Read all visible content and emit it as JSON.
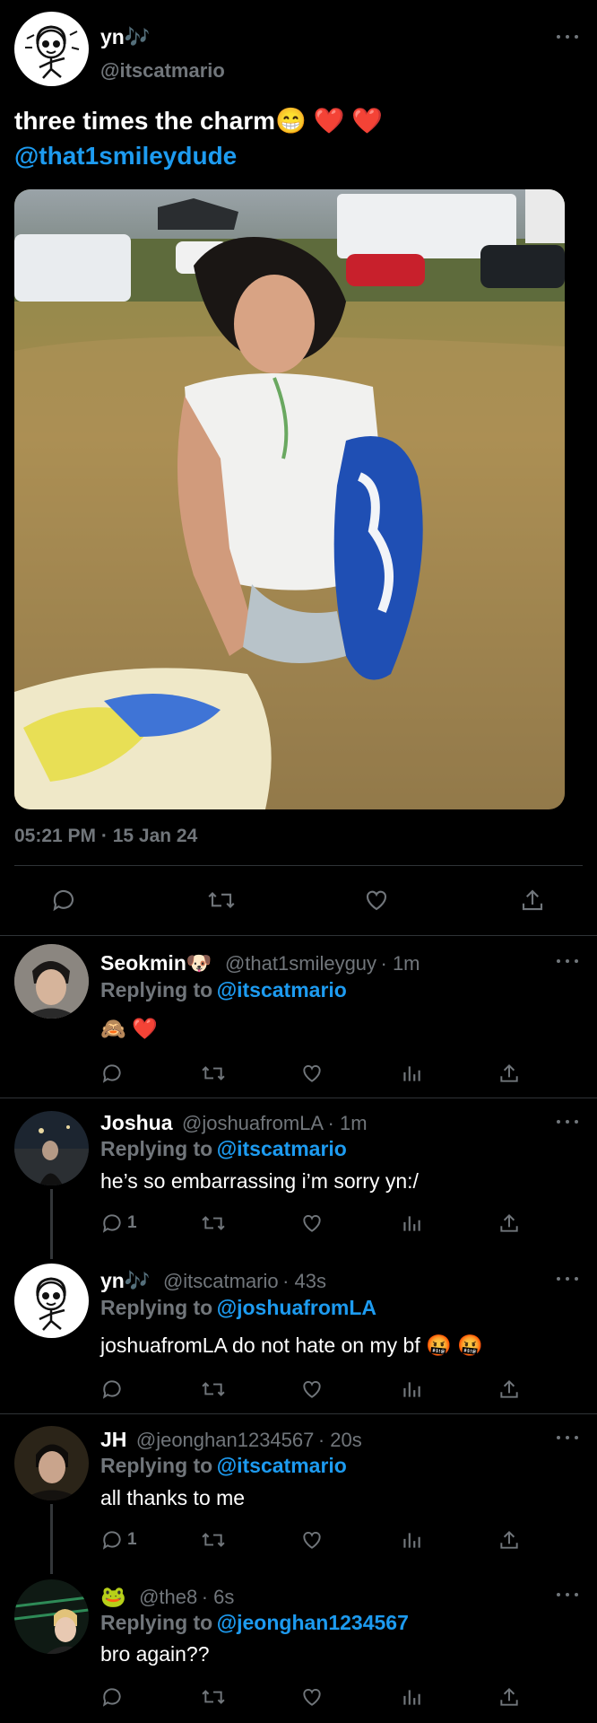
{
  "main_tweet": {
    "name": "yn🎶",
    "handle": "@itscatmario",
    "text": "three times the charm😁 ❤️ ❤️",
    "mention": "@that1smileydude",
    "timestamp": "05:21 PM · 15 Jan 24"
  },
  "replies": [
    {
      "name": "Seokmin🐶",
      "handle": "@that1smileyguy",
      "time": "· 1m",
      "replying_label": "Replying to",
      "replying_to": "@itscatmario",
      "text": "🙈 ❤️",
      "reply_count": ""
    },
    {
      "name": "Joshua",
      "handle": "@joshuafromLA",
      "time": "· 1m",
      "replying_label": "Replying to",
      "replying_to": "@itscatmario",
      "text": "he’s so embarrassing i’m sorry yn:/",
      "reply_count": "1"
    },
    {
      "name": "yn🎶",
      "handle": "@itscatmario",
      "time": "· 43s",
      "replying_label": "Replying to",
      "replying_to": "@joshuafromLA",
      "text": "joshuafromLA do not hate on my bf 🤬 🤬",
      "reply_count": ""
    },
    {
      "name": "JH",
      "handle": "@jeonghan1234567",
      "time": "· 20s",
      "replying_label": "Replying to",
      "replying_to": "@itscatmario",
      "text": "all thanks to me",
      "reply_count": "1"
    },
    {
      "name": "🐸",
      "handle": "@the8",
      "time": "· 6s",
      "replying_label": "Replying to",
      "replying_to": "@jeonghan1234567",
      "text": "bro again??",
      "reply_count": ""
    }
  ],
  "colors": {
    "background": "#000000",
    "accent_blue": "#1d9bf0",
    "secondary_text": "#71767b",
    "divider": "#2f3336"
  },
  "icons": [
    "reply-icon",
    "retweet-icon",
    "like-icon",
    "views-icon",
    "share-icon",
    "more-icon"
  ]
}
